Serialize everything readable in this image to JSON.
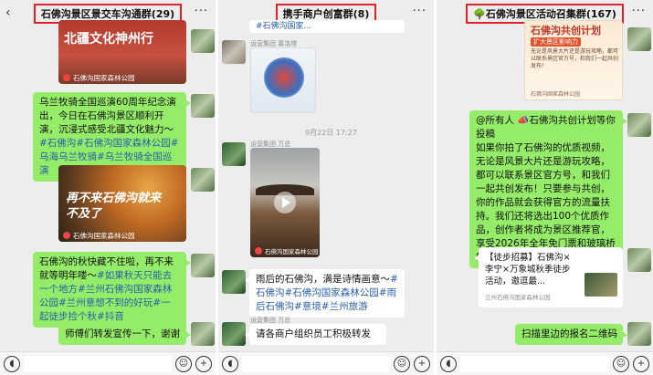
{
  "panels": [
    {
      "title": "石佛沟景区景交车沟通群(29)",
      "back": "‹",
      "more": "···",
      "card1": {
        "text": "北疆文化神州行",
        "source": "石佛沟国家森林公园"
      },
      "bubble1": {
        "lead": "乌兰牧骑全国巡演60周年纪念演出，今日在石佛沟景区顺利开演，沉浸式感受北疆文化魅力～",
        "tags": "#石佛沟#石佛沟国家森林公园#乌海乌兰牧骑#乌兰牧骑全国巡演"
      },
      "card2": {
        "text": "再不来石佛沟就来不及了",
        "source": "石佛沟国家森林公园"
      },
      "bubble2": {
        "lead": "石佛沟的秋快藏不住啦，再不来就等明年喽～",
        "tags": "#如果秋天只能去一个地方#兰州石佛沟国家森林公园#兰州意想不到的好玩#一起徒步捡个秋#抖音"
      },
      "bubble3": {
        "text": "师傅们转发宣传一下，谢谢"
      }
    },
    {
      "title": "携手商户创富群(8)",
      "more": "···",
      "top_bubble": {
        "text": "#石佛沟国家..."
      },
      "sender1": "运营集团 慕洛塔",
      "timestamp": "9月22日 17:27",
      "sender2": "运营集团 万总",
      "card": {
        "source": "石佛沟国家森林公园"
      },
      "bubble1": {
        "lead": "雨后的石佛沟，满是诗情画意～",
        "tags": "#石佛沟#石佛沟国家森林公园#雨后石佛沟#意境#兰州旅游"
      },
      "sender3": "运营集团 万总",
      "bubble2": {
        "text": "请各商户组织员工积极转发"
      }
    },
    {
      "title": "石佛沟景区活动召集群(167)",
      "more": "···",
      "poster": {
        "title": "石佛沟共创计划",
        "subtitle": "扩大景区影响力",
        "body": "无论是风景大片还是游玩攻略，都可以联系景区官方号，和我们一起共创发布！",
        "source": "石佛沟国家森林公园"
      },
      "bubble1": {
        "mention": "@所有人",
        "lead": " 📣石佛沟共创计划等你投稿",
        "body": "如果你拍了石佛沟的优质视频，无论是风景大片还是游玩攻略，都可以联系景区官方号，和我们一起共创发布！只要参与共创，你的作品就会获得官方的流量扶持。我们还将选出100个优质作品，创作者将成为景区推荐官，享受2026年全年免门票和玻璃桥的政策！"
      },
      "link_card": {
        "title": "【徒步招募】石佛沟×李宁×万象城秋季徒步活动，邀逗最...",
        "source": "兰州石佛沟国家森林公园"
      },
      "bubble2": {
        "text": "扫描里边的报名二维码"
      }
    }
  ],
  "colors": {
    "bubble_green": "#95ec69",
    "highlight_red": "#e0202a",
    "link_blue": "#2a5ea8"
  }
}
